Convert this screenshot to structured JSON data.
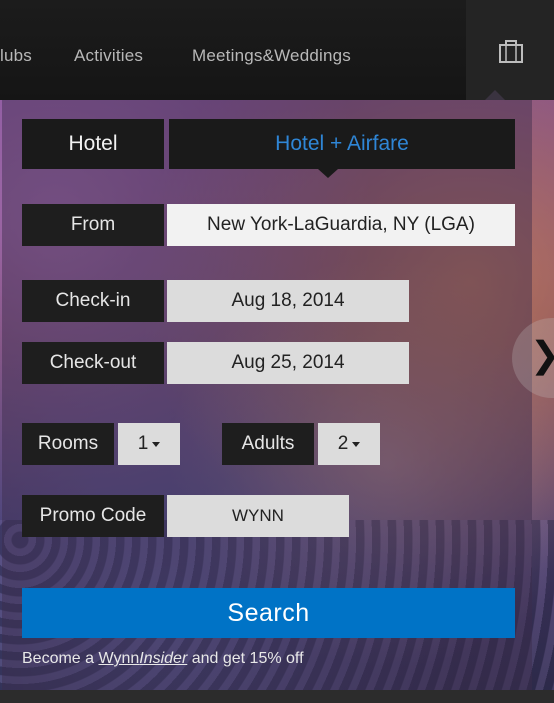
{
  "nav": {
    "items": [
      "lubs",
      "Activities",
      "Meetings&Weddings"
    ],
    "bag_icon": "shopping-bag-icon"
  },
  "tabs": {
    "hotel": "Hotel",
    "hotel_airfare": "Hotel + Airfare",
    "active_color": "#2f86d6"
  },
  "form": {
    "from_label": "From",
    "from_value": "New York-LaGuardia, NY (LGA)",
    "checkin_label": "Check-in",
    "checkin_value": "Aug 18, 2014",
    "checkout_label": "Check-out",
    "checkout_value": "Aug 25, 2014",
    "rooms_label": "Rooms",
    "rooms_value": "1",
    "adults_label": "Adults",
    "adults_value": "2",
    "promo_label": "Promo Code",
    "promo_value": "WYNN"
  },
  "search": {
    "label": "Search",
    "color": "#0073c6"
  },
  "insider": {
    "prefix": "Become a ",
    "link_plain": "Wynn",
    "link_italic": "Insider",
    "suffix": " and get 15% off"
  },
  "carousel": {
    "next_icon": "chevron-right-icon"
  }
}
